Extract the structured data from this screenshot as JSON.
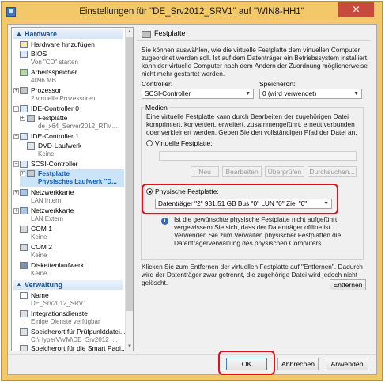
{
  "window": {
    "title": "Einstellungen für \"DE_Srv2012_SRV1\" auf \"WIN8-HH1\"",
    "close_glyph": "✕"
  },
  "tree": {
    "hardware_header": "Hardware",
    "items": [
      {
        "label": "Hardware hinzufügen",
        "icon": "add-hardware-icon"
      },
      {
        "label": "BIOS",
        "sub": "Von \"CD\" starten",
        "icon": "bios-icon"
      },
      {
        "label": "Arbeitsspeicher",
        "sub": "4096 MB",
        "icon": "memory-icon"
      },
      {
        "label": "Prozessor",
        "sub": "2 virtuelle Prozessoren",
        "icon": "processor-icon"
      },
      {
        "label": "IDE-Controller 0",
        "icon": "ide-controller-icon"
      },
      {
        "label": "Festplatte",
        "sub": "de_x64_Server2012_RTM...",
        "icon": "hard-disk-icon"
      },
      {
        "label": "IDE-Controller 1",
        "icon": "ide-controller-icon"
      },
      {
        "label": "DVD-Laufwerk",
        "sub": "Keine",
        "icon": "dvd-drive-icon"
      },
      {
        "label": "SCSI-Controller",
        "icon": "scsi-controller-icon"
      },
      {
        "label": "Festplatte",
        "sub": "Physisches Laufwerk \"D...",
        "icon": "hard-disk-icon"
      },
      {
        "label": "Netzwerkkarte",
        "sub": "LAN Intern",
        "icon": "network-adapter-icon"
      },
      {
        "label": "Netzwerkkarte",
        "sub": "LAN Extern",
        "icon": "network-adapter-icon"
      },
      {
        "label": "COM 1",
        "sub": "Keine",
        "icon": "com-port-icon"
      },
      {
        "label": "COM 2",
        "sub": "Keine",
        "icon": "com-port-icon"
      },
      {
        "label": "Diskettenlaufwerk",
        "sub": "Keine",
        "icon": "floppy-icon"
      }
    ],
    "management_header": "Verwaltung",
    "mgmt_items": [
      {
        "label": "Name",
        "sub": "DE_Srv2012_SRV1"
      },
      {
        "label": "Integrationsdienste",
        "sub": "Einige Dienste verfügbar"
      },
      {
        "label": "Speicherort für Prüfpunktdatei...",
        "sub": "C:\\HyperV\\VM\\DE_Srv2012_..."
      },
      {
        "label": "Speicherort für die Smart Pagi..."
      }
    ]
  },
  "panel": {
    "header": "Festplatte",
    "intro": "Sie können auswählen, wie die virtuelle Festplatte dem virtuellen Computer zugeordnet werden soll. Ist auf dem Datenträger ein Betriebssystem installiert, kann der virtuelle Computer nach dem Ändern der Zuordnung möglicherweise nicht mehr gestartet werden.",
    "controller_label": "Controller:",
    "controller_value": "SCSI-Controller",
    "location_label": "Speicherort:",
    "location_value": "0 (wird verwendet)",
    "media_label": "Medien",
    "media_desc": "Eine virtuelle Festplatte kann durch Bearbeiten der zugehörigen Datei komprimiert, konvertiert, erweitert, zusammengeführt, erneut verbunden oder verkleinert werden. Geben Sie den vollständigen Pfad der Datei an.",
    "virtual_disk_label": "Virtuelle Festplatte:",
    "buttons": {
      "new": "Neu",
      "edit": "Bearbeiten",
      "inspect": "Überprüfen",
      "browse": "Durchsuchen..."
    },
    "physical_disk_label": "Physische Festplatte:",
    "physical_disk_value": "Datenträger \"2\" 931.51 GB Bus \"0\" LUN \"0\" Ziel \"0\"",
    "physical_info": "Ist die gewünschte physische Festplatte nicht aufgeführt, vergewissern Sie sich, dass der Datenträger offline ist. Verwenden Sie zum Verwalten physischer Festplatten die Datenträgerverwaltung des physischen Computers.",
    "remove_desc": "Klicken Sie zum Entfernen der virtuellen Festplatte auf \"Entfernen\". Dadurch wird der Datenträger zwar getrennt, die zugehörige Datei wird jedoch nicht gelöscht.",
    "remove_button": "Entfernen"
  },
  "footer": {
    "ok": "OK",
    "cancel": "Abbrechen",
    "apply": "Anwenden"
  },
  "colors": {
    "window_frame": "#f2c86a",
    "highlight": "#e0101c",
    "selection": "#cce4f7"
  }
}
